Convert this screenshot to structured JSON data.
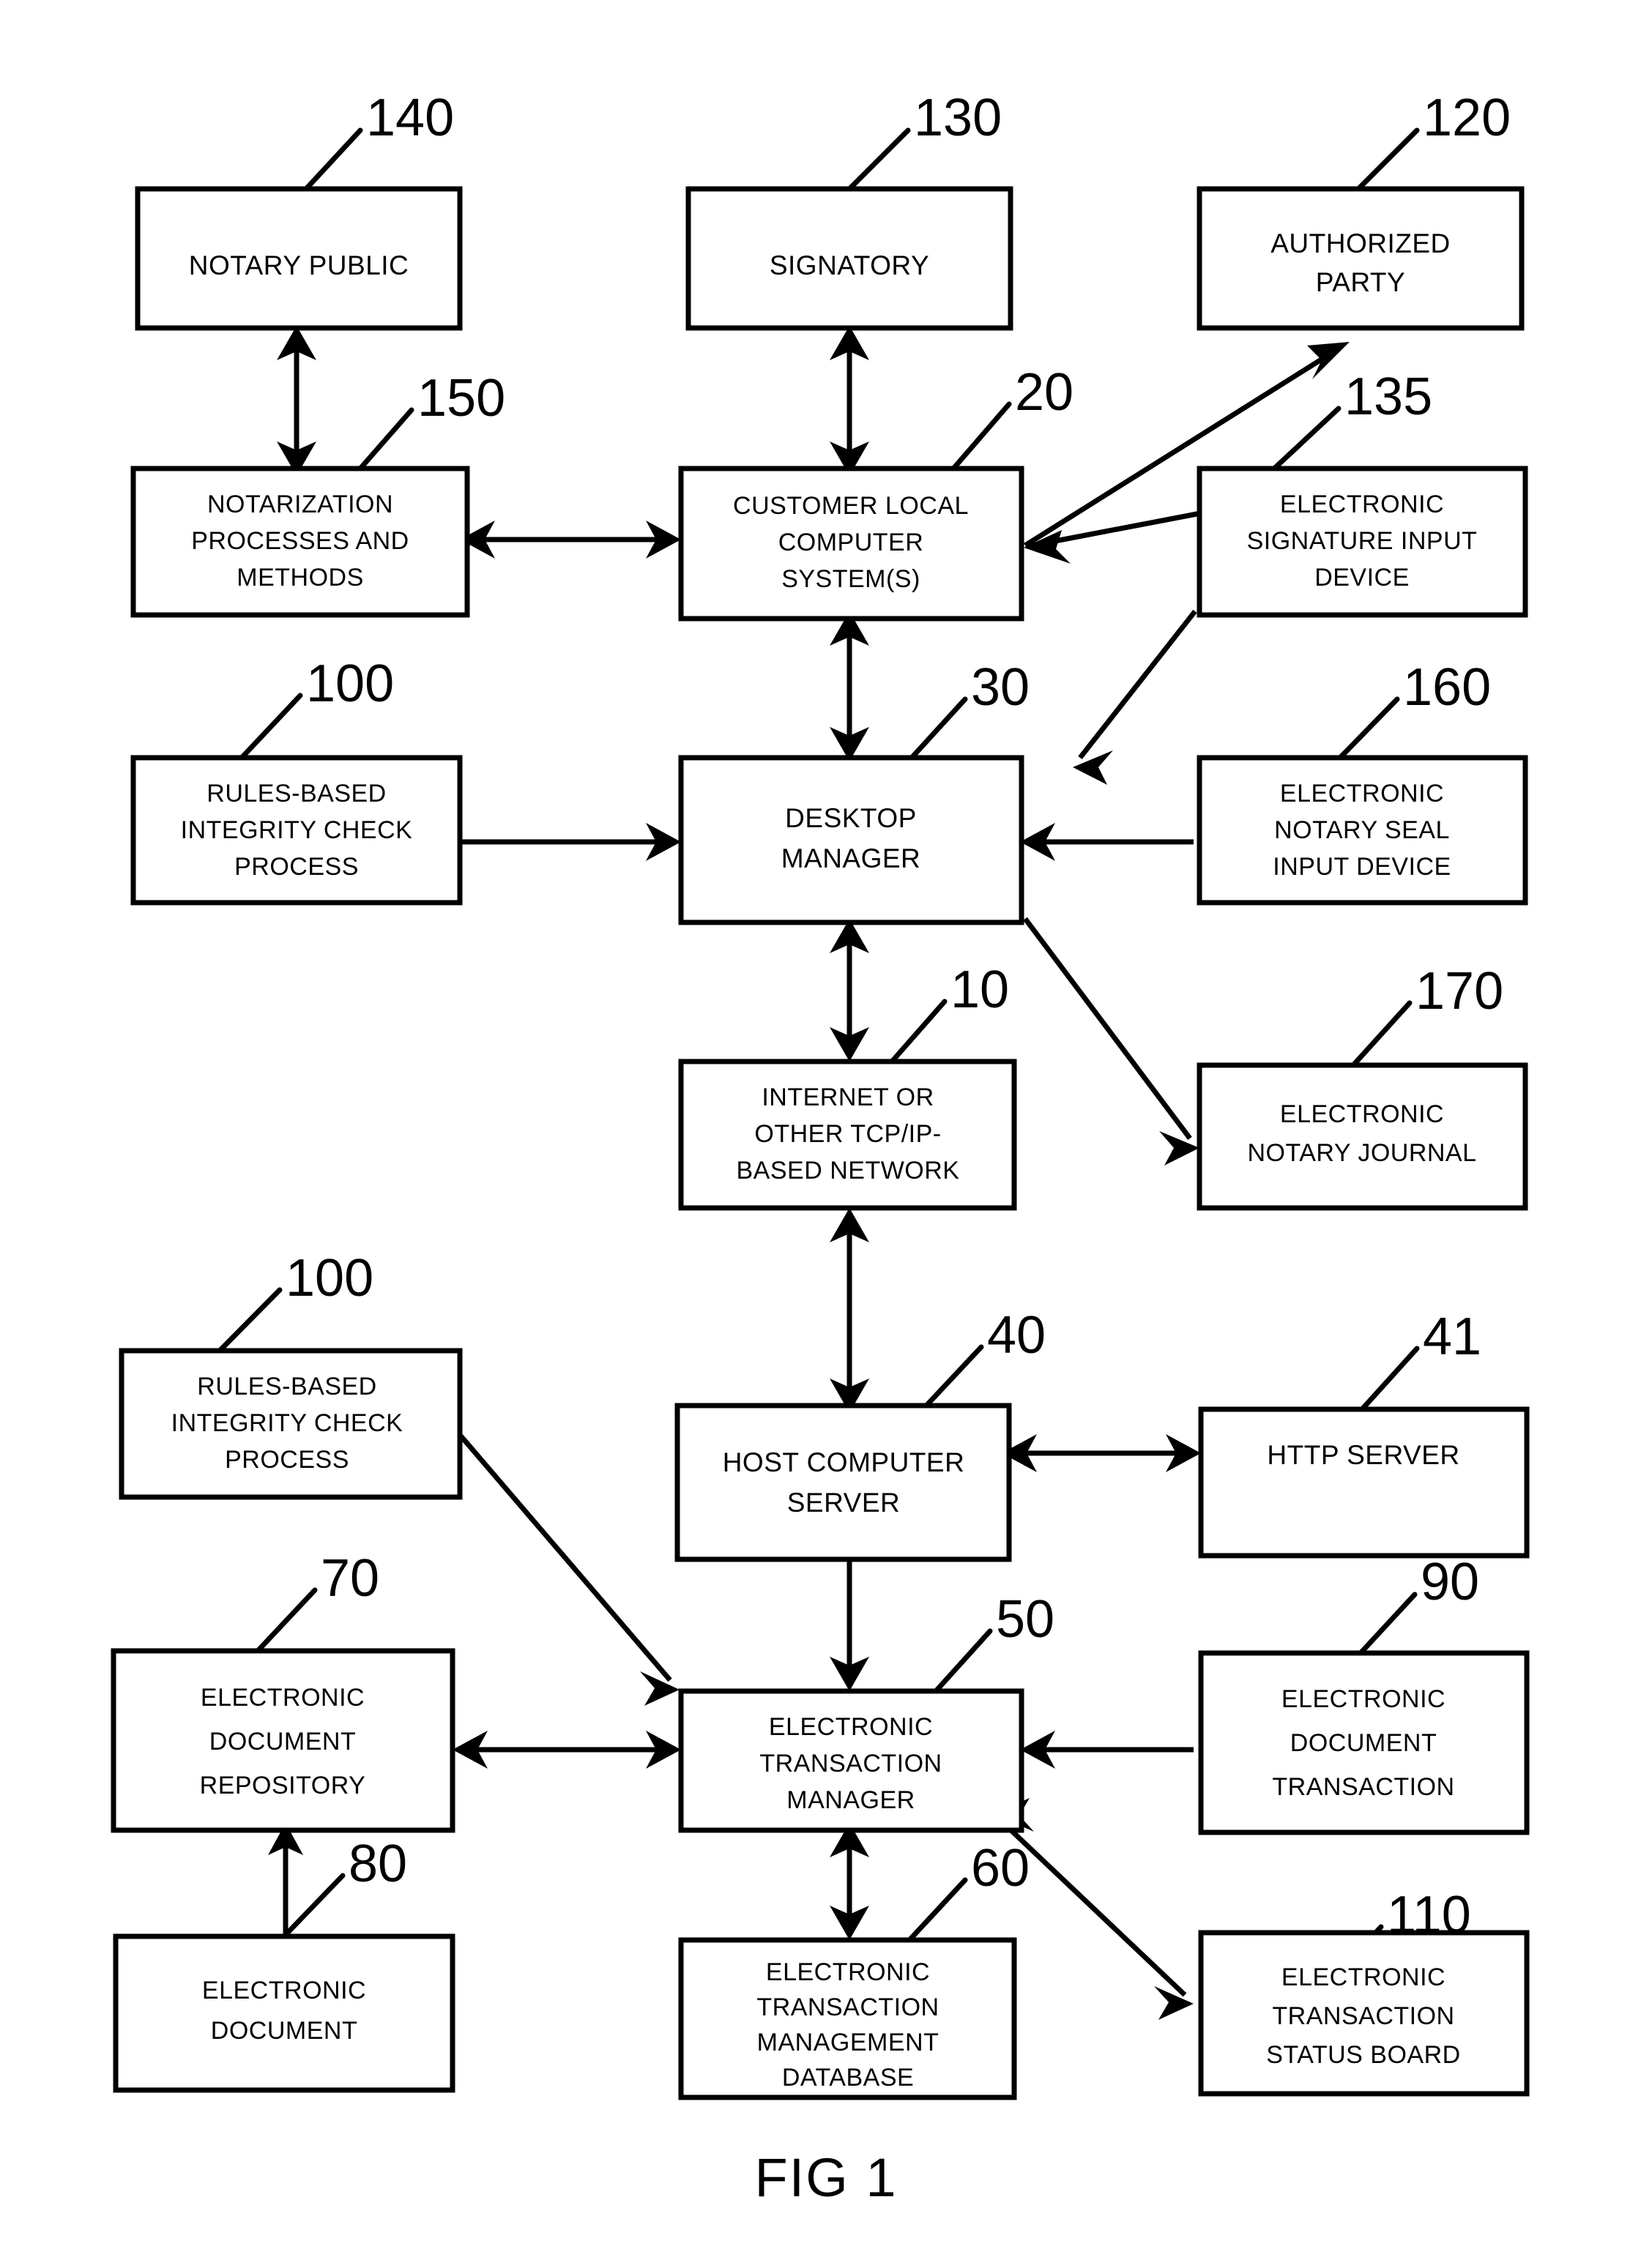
{
  "figure": {
    "caption": "FIG 1",
    "title": "Electronic notarization and transaction management system block diagram"
  },
  "nodes": [
    {
      "id": "notary_public",
      "ref": "140",
      "lines": [
        "NOTARY PUBLIC"
      ]
    },
    {
      "id": "signatory",
      "ref": "130",
      "lines": [
        "SIGNATORY"
      ]
    },
    {
      "id": "authorized_party",
      "ref": "120",
      "lines": [
        "AUTHORIZED",
        "PARTY"
      ]
    },
    {
      "id": "notarization",
      "ref": "150",
      "lines": [
        "NOTARIZATION",
        "PROCESSES AND",
        "METHODS"
      ]
    },
    {
      "id": "customer_local",
      "ref": "20",
      "lines": [
        "CUSTOMER LOCAL",
        "COMPUTER",
        "SYSTEM(S)"
      ]
    },
    {
      "id": "esig_input",
      "ref": "135",
      "lines": [
        "ELECTRONIC",
        "SIGNATURE INPUT",
        "DEVICE"
      ]
    },
    {
      "id": "rules_top",
      "ref": "100",
      "lines": [
        "RULES-BASED",
        "INTEGRITY CHECK",
        "PROCESS"
      ]
    },
    {
      "id": "desktop_manager",
      "ref": "30",
      "lines": [
        "DESKTOP",
        "MANAGER"
      ]
    },
    {
      "id": "notary_seal_input",
      "ref": "160",
      "lines": [
        "ELECTRONIC",
        "NOTARY SEAL",
        "INPUT DEVICE"
      ]
    },
    {
      "id": "internet",
      "ref": "10",
      "lines": [
        "INTERNET OR",
        "OTHER TCP/IP-",
        "BASED NETWORK"
      ]
    },
    {
      "id": "notary_journal",
      "ref": "170",
      "lines": [
        "ELECTRONIC",
        "NOTARY JOURNAL"
      ]
    },
    {
      "id": "rules_bottom",
      "ref": "100",
      "lines": [
        "RULES-BASED",
        "INTEGRITY CHECK",
        "PROCESS"
      ]
    },
    {
      "id": "host_server",
      "ref": "40",
      "lines": [
        "HOST COMPUTER",
        "SERVER"
      ]
    },
    {
      "id": "http_server",
      "ref": "41",
      "lines": [
        "HTTP SERVER"
      ]
    },
    {
      "id": "doc_repository",
      "ref": "70",
      "lines": [
        "ELECTRONIC",
        "DOCUMENT",
        "REPOSITORY"
      ]
    },
    {
      "id": "transaction_manager",
      "ref": "50",
      "lines": [
        "ELECTRONIC",
        "TRANSACTION",
        "MANAGER"
      ]
    },
    {
      "id": "doc_transaction",
      "ref": "90",
      "lines": [
        "ELECTRONIC",
        "DOCUMENT",
        "TRANSACTION"
      ]
    },
    {
      "id": "electronic_document",
      "ref": "80",
      "lines": [
        "ELECTRONIC",
        "DOCUMENT"
      ]
    },
    {
      "id": "transaction_db",
      "ref": "60",
      "lines": [
        "ELECTRONIC",
        "TRANSACTION",
        "MANAGEMENT",
        "DATABASE"
      ]
    },
    {
      "id": "status_board",
      "ref": "110",
      "lines": [
        "ELECTRONIC",
        "TRANSACTION",
        "STATUS BOARD"
      ]
    }
  ],
  "connections": [
    {
      "from": "notarization",
      "to": "notary_public",
      "style": "double-arrow-vertical"
    },
    {
      "from": "customer_local",
      "to": "signatory",
      "style": "double-arrow-vertical"
    },
    {
      "from": "notarization",
      "to": "customer_local",
      "style": "double-arrow-horizontal"
    },
    {
      "from": "customer_local",
      "to": "authorized_party",
      "style": "single-arrow-diagonal"
    },
    {
      "from": "esig_input",
      "to": "customer_local",
      "style": "single-arrow-diagonal"
    },
    {
      "from": "customer_local",
      "to": "desktop_manager",
      "style": "double-arrow-vertical"
    },
    {
      "from": "rules_top",
      "to": "desktop_manager",
      "style": "single-arrow-horizontal"
    },
    {
      "from": "esig_input",
      "to": "desktop_manager",
      "style": "single-arrow-diagonal"
    },
    {
      "from": "notary_seal_input",
      "to": "desktop_manager",
      "style": "single-arrow-horizontal"
    },
    {
      "from": "desktop_manager",
      "to": "notary_journal",
      "style": "single-arrow-diagonal"
    },
    {
      "from": "desktop_manager",
      "to": "internet",
      "style": "double-arrow-vertical"
    },
    {
      "from": "internet",
      "to": "host_server",
      "style": "double-arrow-vertical"
    },
    {
      "from": "host_server",
      "to": "http_server",
      "style": "double-arrow-horizontal"
    },
    {
      "from": "host_server",
      "to": "transaction_manager",
      "style": "double-arrow-vertical"
    },
    {
      "from": "rules_bottom",
      "to": "transaction_manager",
      "style": "single-arrow-diagonal"
    },
    {
      "from": "transaction_manager",
      "to": "doc_repository",
      "style": "double-arrow-horizontal"
    },
    {
      "from": "doc_transaction",
      "to": "transaction_manager",
      "style": "single-arrow-horizontal"
    },
    {
      "from": "electronic_document",
      "to": "doc_repository",
      "style": "single-arrow-vertical"
    },
    {
      "from": "transaction_manager",
      "to": "transaction_db",
      "style": "double-arrow-vertical"
    },
    {
      "from": "transaction_manager",
      "to": "status_board",
      "style": "double-arrow-diagonal"
    }
  ],
  "colors": {
    "ink": "#000000",
    "paper": "#ffffff"
  }
}
